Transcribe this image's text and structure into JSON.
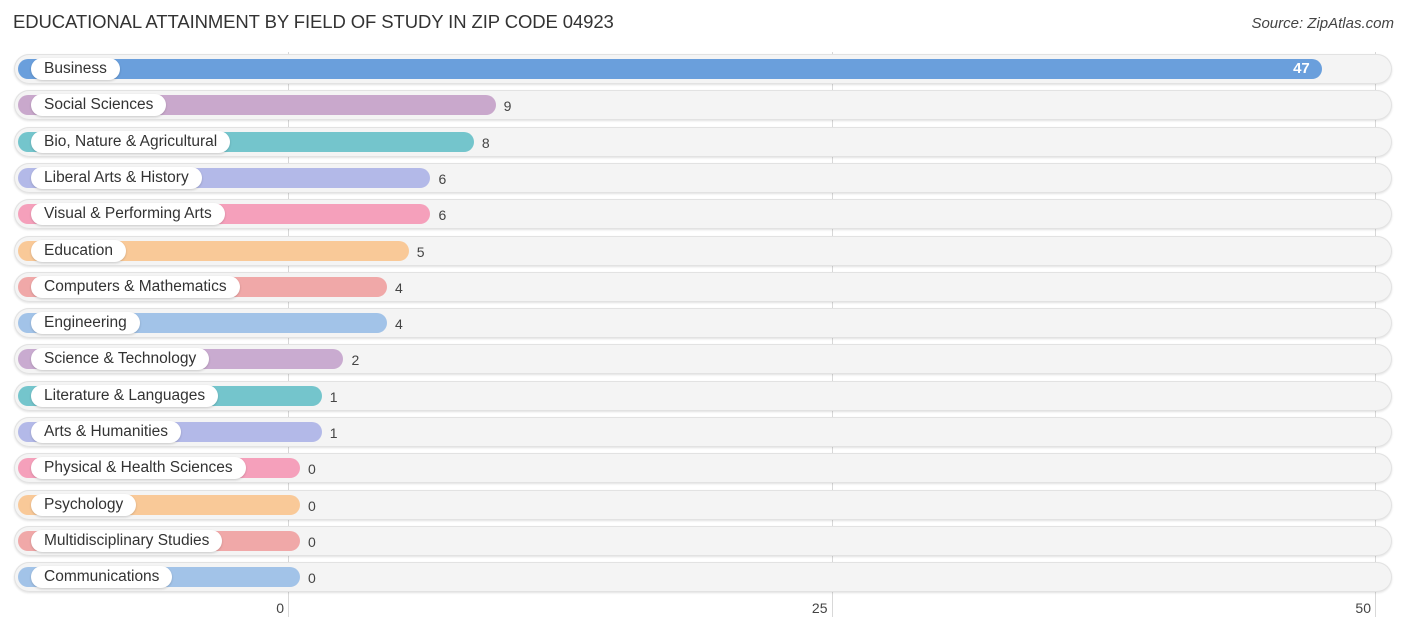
{
  "header": {
    "title": "EDUCATIONAL ATTAINMENT BY FIELD OF STUDY IN ZIP CODE 04923",
    "source": "Source: ZipAtlas.com"
  },
  "chart_data": {
    "type": "bar",
    "orientation": "horizontal",
    "title": "EDUCATIONAL ATTAINMENT BY FIELD OF STUDY IN ZIP CODE 04923",
    "xlabel": "",
    "ylabel": "",
    "xlim": [
      0,
      50
    ],
    "xticks": [
      0,
      25,
      50
    ],
    "xtick_labels": [
      "0",
      "25",
      "50"
    ],
    "grid": true,
    "categories": [
      "Business",
      "Social Sciences",
      "Bio, Nature & Agricultural",
      "Liberal Arts & History",
      "Visual & Performing Arts",
      "Education",
      "Computers & Mathematics",
      "Engineering",
      "Science & Technology",
      "Literature & Languages",
      "Arts & Humanities",
      "Physical & Health Sciences",
      "Psychology",
      "Multidisciplinary Studies",
      "Communications"
    ],
    "values": [
      47,
      9,
      8,
      6,
      6,
      5,
      4,
      4,
      2,
      1,
      1,
      0,
      0,
      0,
      0
    ],
    "value_labels": [
      "47",
      "9",
      "8",
      "6",
      "6",
      "5",
      "4",
      "4",
      "2",
      "1",
      "1",
      "0",
      "0",
      "0",
      "0"
    ],
    "colors": [
      "#6a9fdc",
      "#c9a8cc",
      "#74c5cc",
      "#b3b9e8",
      "#f5a0bb",
      "#f9c998",
      "#f0a8a8",
      "#a2c3e8",
      "#c9abd0",
      "#74c5cc",
      "#b3b9e8",
      "#f5a0bb",
      "#f9c998",
      "#f0a8a8",
      "#a2c3e8"
    ]
  }
}
